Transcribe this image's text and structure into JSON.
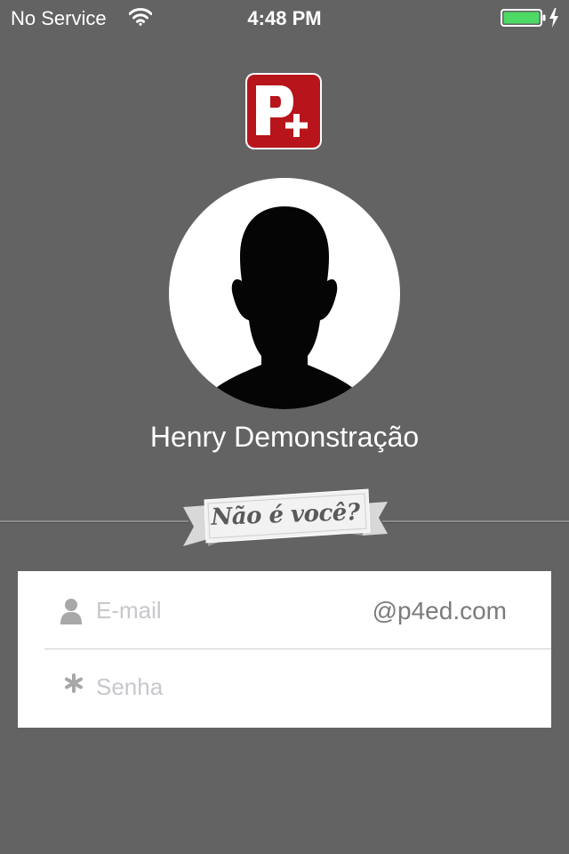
{
  "status_bar": {
    "carrier": "No Service",
    "time": "4:48 PM",
    "battery_color": "#4cd964",
    "icons": [
      "wifi-icon",
      "battery-icon",
      "charging-icon"
    ]
  },
  "logo": {
    "text": "P+",
    "brand_color": "#b8141b"
  },
  "profile": {
    "name": "Henry Demonstração",
    "avatar_icon": "user-silhouette-icon"
  },
  "switch_user": {
    "label": "Não é você?"
  },
  "login_form": {
    "email_placeholder": "E-mail",
    "email_value": "",
    "email_domain": "@p4ed.com",
    "password_placeholder": "Senha",
    "password_value": ""
  },
  "colors": {
    "background": "#636363",
    "form_background": "#ffffff",
    "placeholder": "#c7c7cc",
    "icon_gray": "#a8a8a8"
  }
}
